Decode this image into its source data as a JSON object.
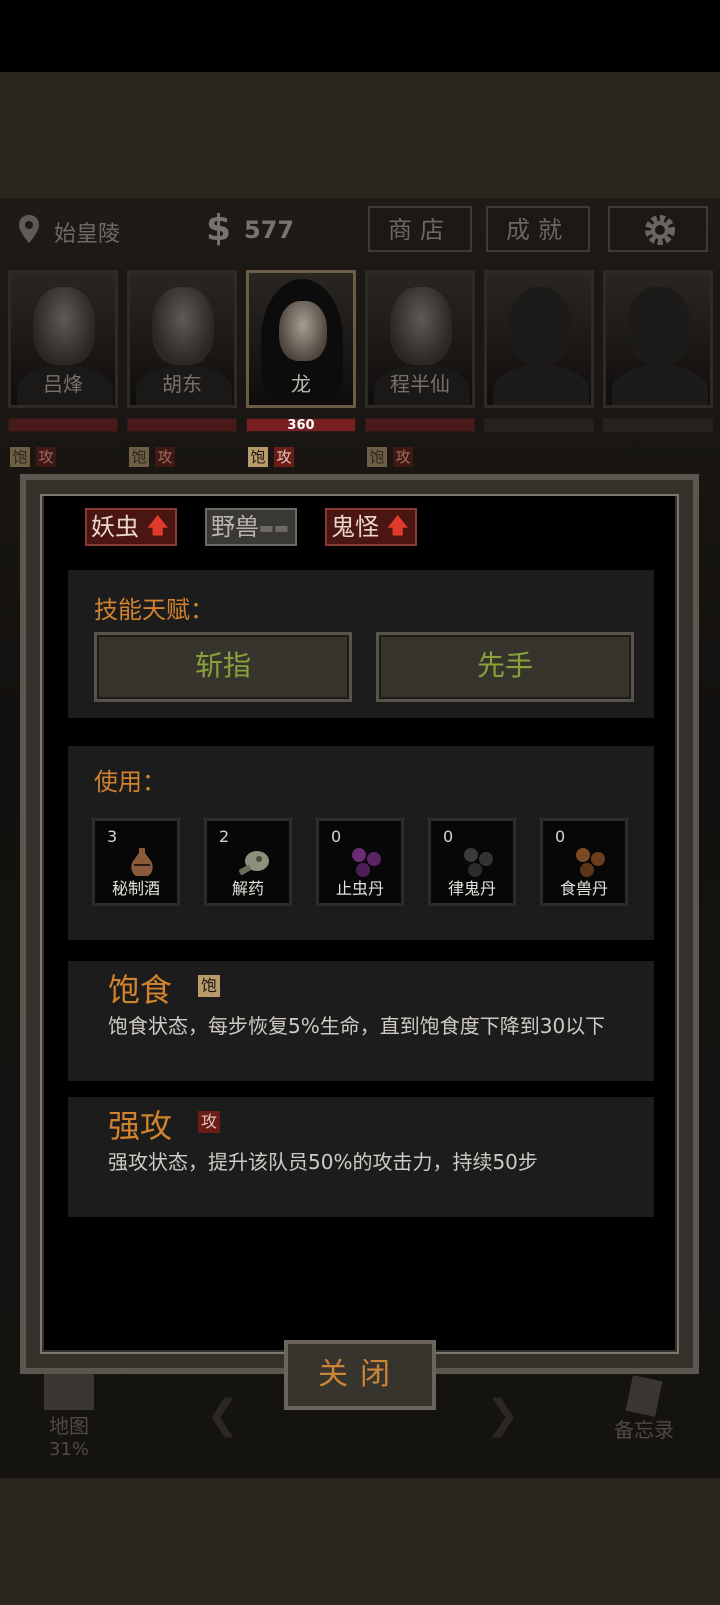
{
  "header": {
    "location": "始皇陵",
    "money": "577",
    "shop_label": "商店",
    "achievements_label": "成就",
    "settings_icon": "gear-icon"
  },
  "party": [
    {
      "name": "吕烽",
      "hp_text": "",
      "active": false
    },
    {
      "name": "胡东",
      "hp_text": "",
      "active": false
    },
    {
      "name": "龙",
      "hp_text": "360",
      "active": true
    },
    {
      "name": "程半仙",
      "hp_text": "",
      "active": false
    },
    {
      "name": "",
      "hp_text": "",
      "active": false
    },
    {
      "name": "",
      "hp_text": "",
      "active": false
    }
  ],
  "status_badges": {
    "satiated": "饱",
    "attack": "攻"
  },
  "resist": [
    {
      "label": "妖虫",
      "indicator": "up"
    },
    {
      "label": "野兽",
      "indicator": "neutral"
    },
    {
      "label": "鬼怪",
      "indicator": "up"
    }
  ],
  "skills": {
    "title": "技能天赋：",
    "items": [
      "斩指",
      "先手"
    ]
  },
  "use": {
    "title": "使用：",
    "items": [
      {
        "count": "3",
        "name": "秘制酒",
        "icon": "wine-jar-icon"
      },
      {
        "count": "2",
        "name": "解药",
        "icon": "antidote-flask-icon"
      },
      {
        "count": "0",
        "name": "止虫丹",
        "icon": "purple-pills-icon"
      },
      {
        "count": "0",
        "name": "律鬼丹",
        "icon": "gray-pills-icon"
      },
      {
        "count": "0",
        "name": "食兽丹",
        "icon": "brown-pills-icon"
      }
    ]
  },
  "statuses": [
    {
      "title": "饱食",
      "badge": "饱",
      "desc": "饱食状态，每步恢复5%生命，直到饱食度下降到30以下"
    },
    {
      "title": "强攻",
      "badge": "攻",
      "desc": "强攻状态，提升该队员50%的攻击力，持续50步"
    }
  ],
  "close_label": "关闭",
  "bottom": {
    "map_label": "地图",
    "map_progress": "31%",
    "memo_label": "备忘录"
  },
  "colors": {
    "accent_orange": "#d0822f",
    "skill_green": "#87a13b",
    "hp_red": "#7a1f1f",
    "up_arrow": "#e03a2a"
  }
}
